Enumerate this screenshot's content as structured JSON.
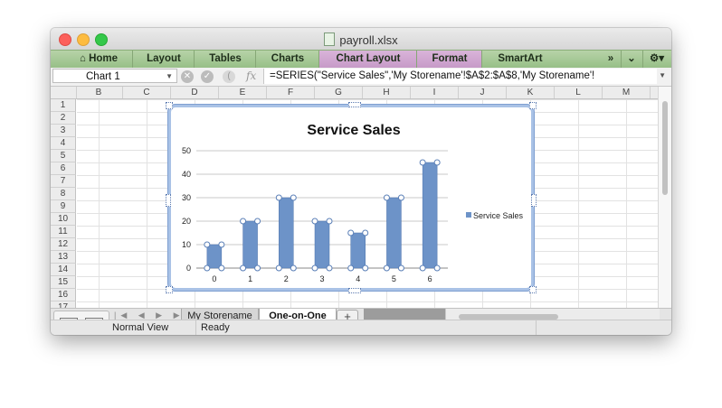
{
  "window": {
    "title": "payroll.xlsx"
  },
  "ribbon": {
    "tabs": [
      {
        "label": "Home",
        "style": "normal"
      },
      {
        "label": "Layout",
        "style": "normal"
      },
      {
        "label": "Tables",
        "style": "normal"
      },
      {
        "label": "Charts",
        "style": "normal"
      },
      {
        "label": "Chart Layout",
        "style": "purple"
      },
      {
        "label": "Format",
        "style": "purple"
      },
      {
        "label": "SmartArt",
        "style": "normal"
      }
    ],
    "overflow": "»"
  },
  "formula_bar": {
    "name_box": "Chart 1",
    "fx": "fx",
    "formula": "=SERIES(\"Service Sales\",'My Storename'!$A$2:$A$8,'My Storename'!"
  },
  "sheet": {
    "columns": [
      "B",
      "C",
      "D",
      "E",
      "F",
      "G",
      "H",
      "I",
      "J",
      "K",
      "L",
      "M"
    ],
    "rows": [
      "1",
      "2",
      "3",
      "4",
      "5",
      "6",
      "7",
      "8",
      "9",
      "10",
      "11",
      "12",
      "13",
      "14",
      "15",
      "16",
      "17"
    ]
  },
  "chart_data": {
    "type": "bar",
    "title": "Service Sales",
    "categories": [
      "0",
      "1",
      "2",
      "3",
      "4",
      "5",
      "6"
    ],
    "series": [
      {
        "name": "Service Sales",
        "values": [
          10,
          20,
          30,
          20,
          15,
          30,
          45
        ],
        "color": "#6d93c8"
      }
    ],
    "yticks": [
      "0",
      "10",
      "20",
      "30",
      "40",
      "50"
    ],
    "ylim": [
      0,
      50
    ],
    "grid": true,
    "legend": "right",
    "xlabel": "",
    "ylabel": ""
  },
  "sheet_tabs": [
    {
      "label": "My Storename",
      "active": false
    },
    {
      "label": "One-on-One",
      "active": true
    }
  ],
  "add_sheet": "+",
  "status": {
    "view": "Normal View",
    "state": "Ready"
  },
  "colors": {
    "ribbon": "#a7c998",
    "contextual_tab": "#cfa6d0",
    "chart_border": "#a9c2e6",
    "bar": "#6d93c8"
  }
}
